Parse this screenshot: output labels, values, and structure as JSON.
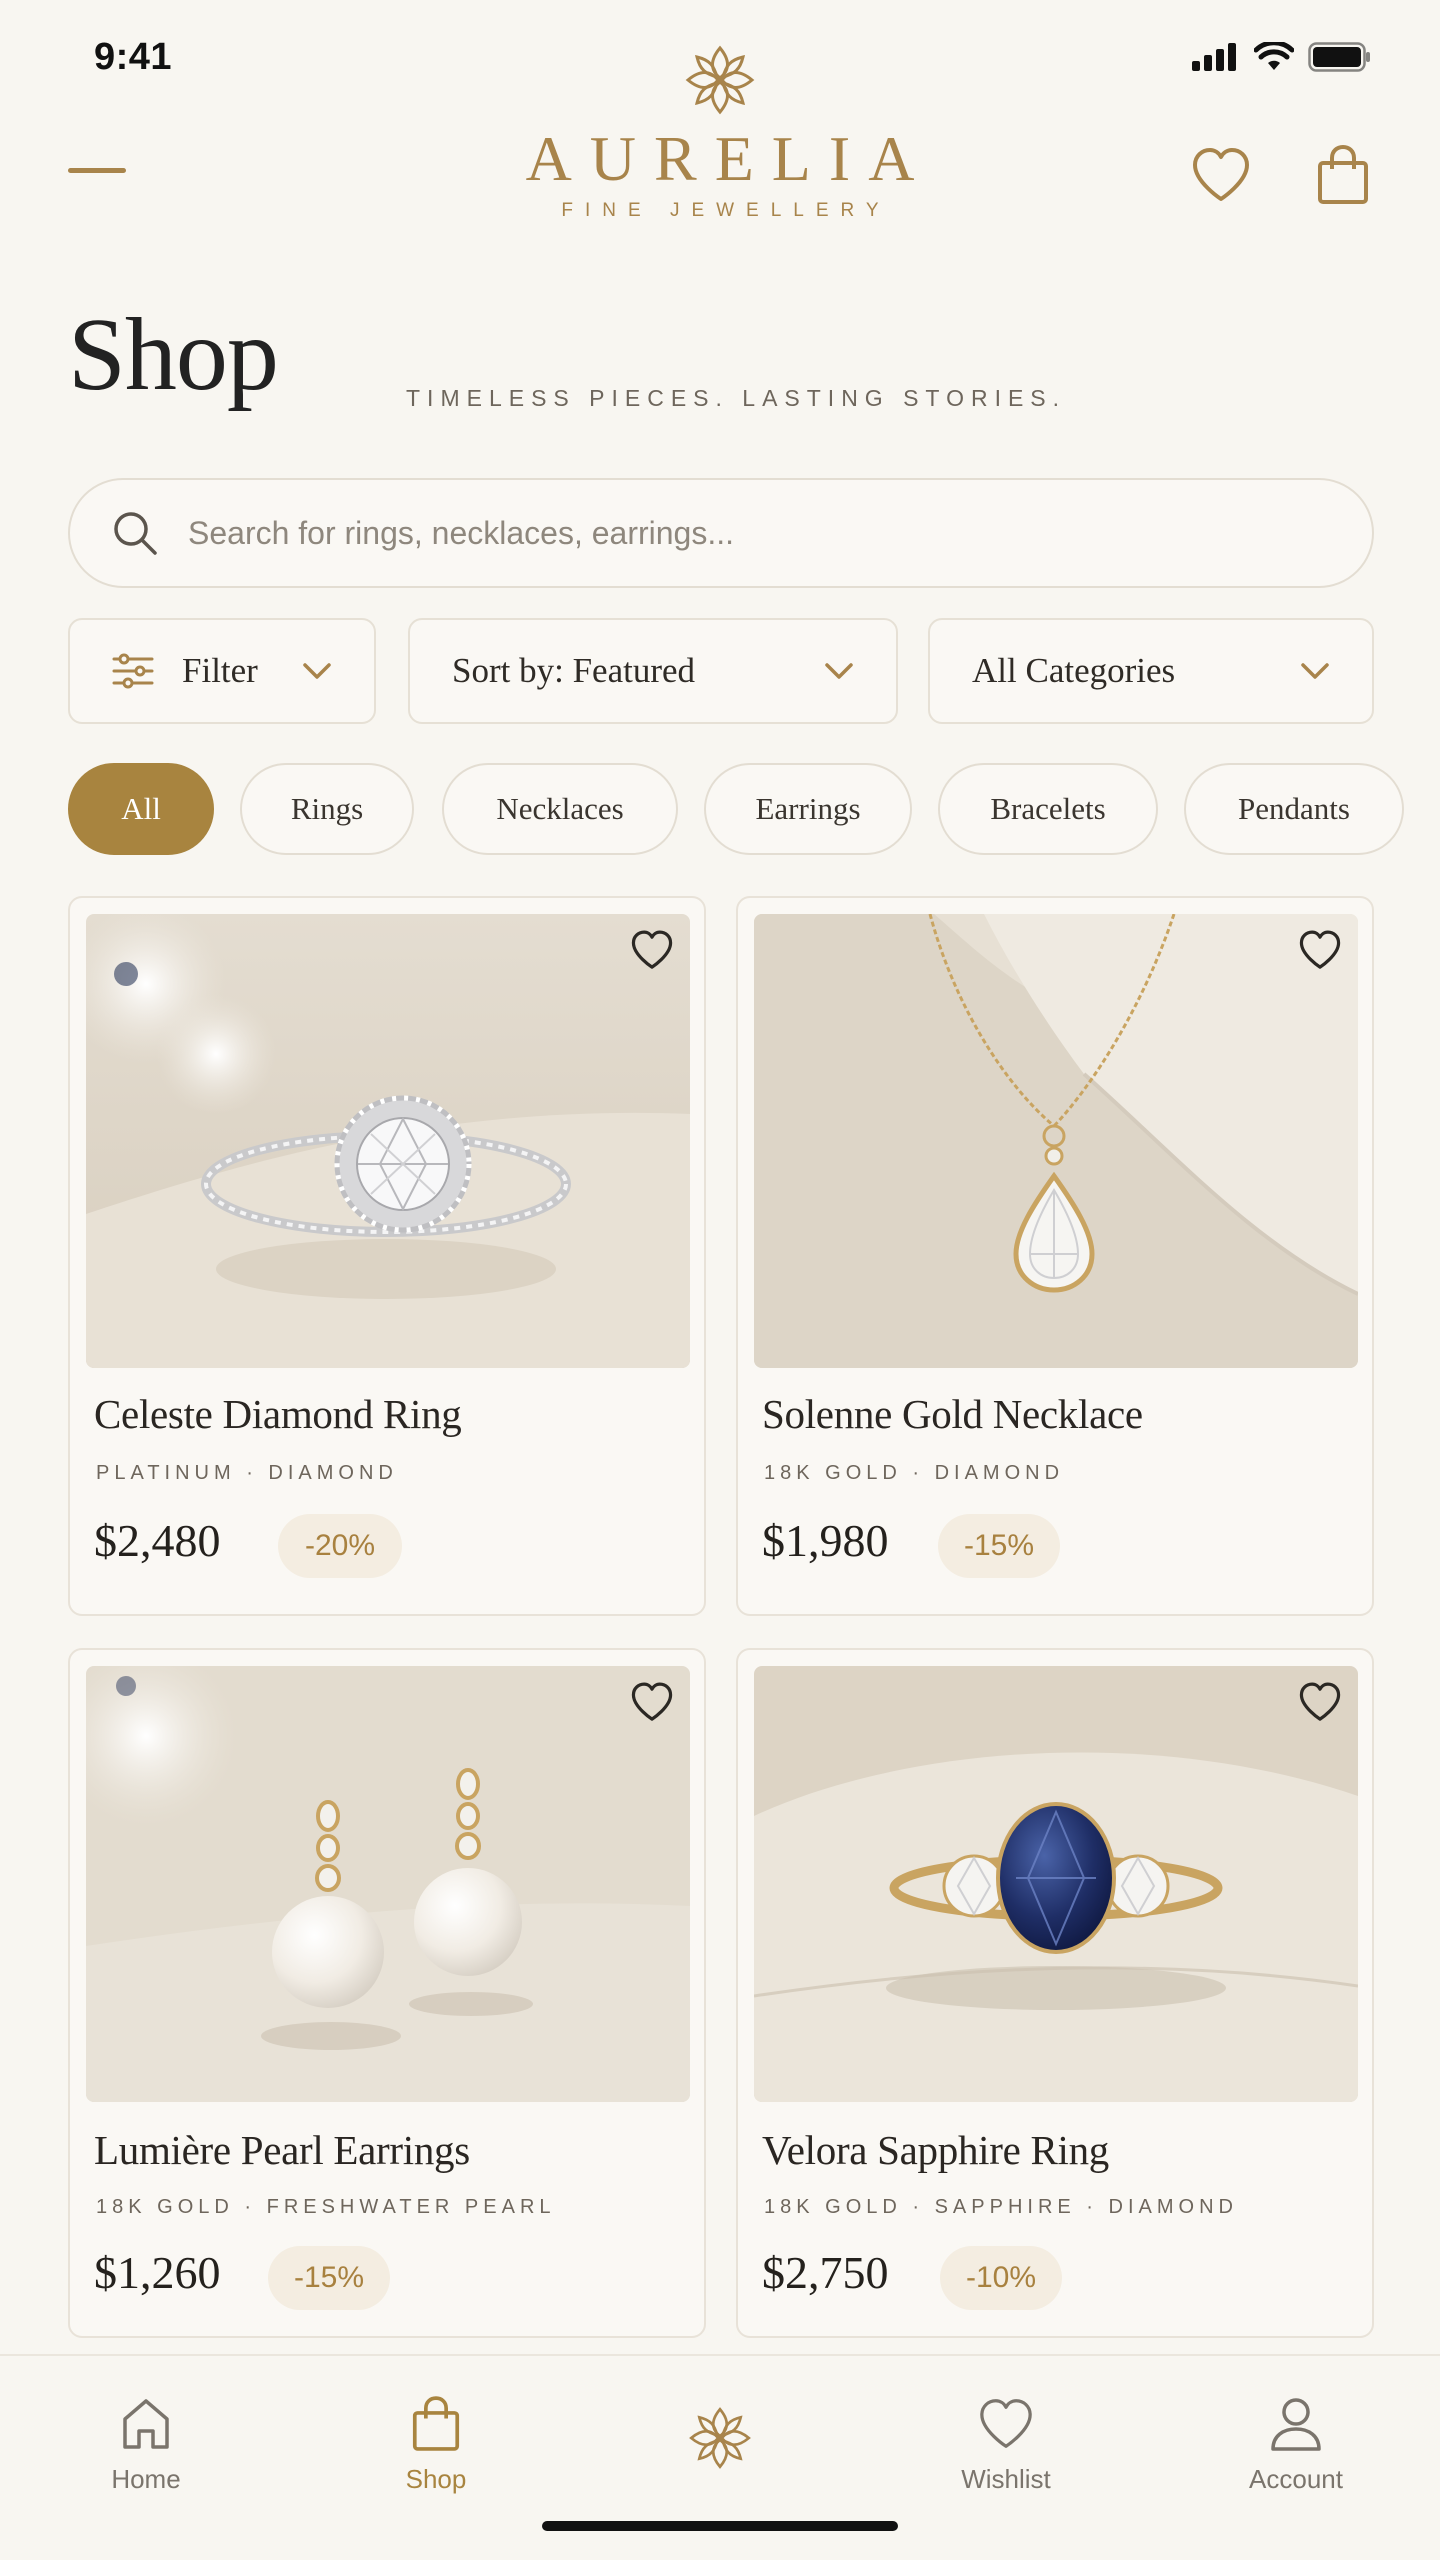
{
  "status_bar": {
    "time": "9:41"
  },
  "header": {
    "brand_name": "AURELIA",
    "brand_sub": "FINE JEWELLERY"
  },
  "page": {
    "title": "Shop",
    "tagline": "TIMELESS PIECES. LASTING STORIES."
  },
  "search": {
    "placeholder": "Search for rings, necklaces, earrings..."
  },
  "filters": {
    "filter_label": "Filter",
    "sort_label": "Sort by: Featured",
    "category_label": "All Categories"
  },
  "chips": [
    "All",
    "Rings",
    "Necklaces",
    "Earrings",
    "Bracelets",
    "Pendants"
  ],
  "active_chip": "All",
  "products": [
    {
      "name": "Celeste Diamond Ring",
      "meta": "PLATINUM · DIAMOND",
      "price": "$2,480",
      "discount": "-20%"
    },
    {
      "name": "Solenne Gold Necklace",
      "meta": "18K GOLD · DIAMOND",
      "price": "$1,980",
      "discount": "-15%"
    },
    {
      "name": "Lumière Pearl Earrings",
      "meta": "18K GOLD · FRESHWATER PEARL",
      "price": "$1,260",
      "discount": "-15%"
    },
    {
      "name": "Velora Sapphire Ring",
      "meta": "18K GOLD · SAPPHIRE · DIAMOND",
      "price": "$2,750",
      "discount": "-10%"
    }
  ],
  "bottom_nav": {
    "home": "Home",
    "shop": "Shop",
    "wishlist": "Wishlist",
    "account": "Account",
    "active": "Shop"
  },
  "colors": {
    "accent": "#a8843f",
    "background": "#f8f6f1",
    "text": "#2a2723",
    "discount_bg": "#f4ede1"
  },
  "icons": [
    "menu-icon",
    "flower-logo-icon",
    "heart-icon",
    "bag-icon",
    "search-icon",
    "sliders-icon",
    "chevron-down-icon",
    "home-icon",
    "user-icon"
  ]
}
